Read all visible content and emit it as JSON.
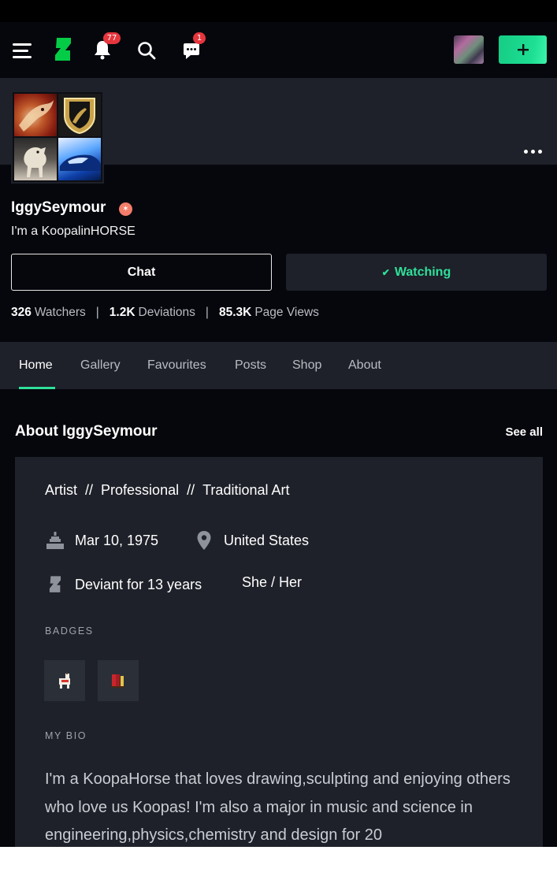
{
  "topbar": {
    "notifications_count": "77",
    "messages_count": "1"
  },
  "profile": {
    "username": "IggySeymour",
    "tagline": "I'm a KoopalinHORSE",
    "chat_label": "Chat",
    "watch_label": "Watching",
    "stats": {
      "watchers_value": "326",
      "watchers_label": "Watchers",
      "deviations_value": "1.2K",
      "deviations_label": "Deviations",
      "views_value": "85.3K",
      "views_label": "Page Views",
      "separator": "|"
    }
  },
  "tabs": [
    {
      "label": "Home"
    },
    {
      "label": "Gallery"
    },
    {
      "label": "Favourites"
    },
    {
      "label": "Posts"
    },
    {
      "label": "Shop"
    },
    {
      "label": "About"
    }
  ],
  "about": {
    "title": "About IggySeymour",
    "see_all": "See all",
    "roles": [
      "Artist",
      "Professional",
      "Traditional Art"
    ],
    "role_separator": "//",
    "birthday": "Mar 10, 1975",
    "location": "United States",
    "member_for": "Deviant for 13 years",
    "pronouns": "She / Her",
    "badges_label": "BADGES",
    "bio_label": "MY BIO",
    "bio": "I'm a KoopaHorse that loves drawing,sculpting and enjoying others who love us Koopas! I'm also a major in music and science in engineering,physics,chemistry and design for 20"
  },
  "colors": {
    "accent": "#2fe09a",
    "background": "#06070d",
    "surface": "#1e2129",
    "notification": "#e5353d",
    "core_badge": "#f37d6a"
  },
  "icons": [
    "menu-icon",
    "deviantart-logo-icon",
    "bell-icon",
    "search-icon",
    "chat-bubble-icon",
    "plus-icon",
    "more-dots-icon",
    "star-badge-icon",
    "check-icon",
    "birthday-cake-icon",
    "location-pin-icon",
    "deviantart-logo-icon"
  ]
}
